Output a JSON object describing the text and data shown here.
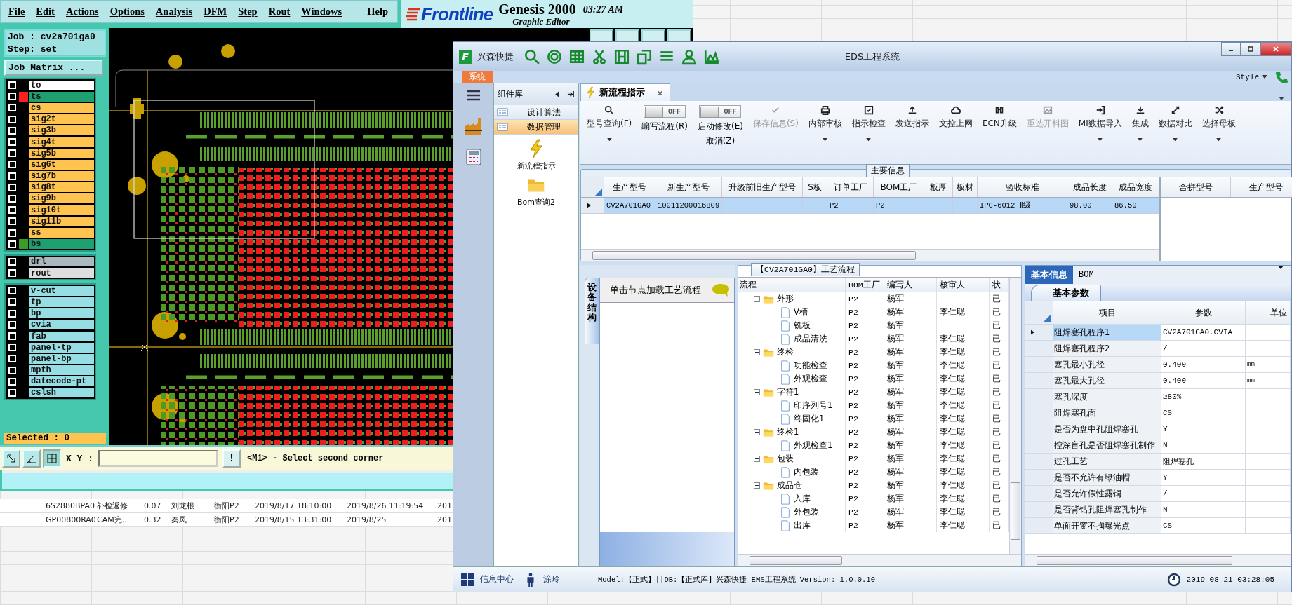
{
  "spreadsheet": {
    "rows": [
      [
        "6S2880BPA0",
        "补检返修",
        "0.07",
        "刘龙根",
        "衡阳P2",
        "2019/8/17 18:10:00",
        "2019/8/26 11:19:54",
        "201"
      ],
      [
        "GP00800RA0",
        "CAM完...",
        "0.32",
        "秦凤",
        "衡阳P2",
        "2019/8/15 13:31:00",
        "2019/8/25",
        "201"
      ]
    ]
  },
  "genesis": {
    "menu": [
      "File",
      "Edit",
      "Actions",
      "Options",
      "Analysis",
      "DFM",
      "Step",
      "Rout",
      "Windows",
      "Help"
    ],
    "logo": "Frontline",
    "product": "Genesis 2000",
    "subtitle": "Graphic Editor",
    "clock": "03:27 AM",
    "job": "Job : cv2a701ga0",
    "step": "Step: set",
    "job_matrix_button": "Job Matrix ...",
    "layer_groups": [
      {
        "layers": [
          {
            "name": "to",
            "color": "#ffffff",
            "checked": false
          },
          {
            "name": "ts",
            "color": "#1fa070",
            "checked": false,
            "swatch": {
              "color": "#ff1f1f"
            }
          },
          {
            "name": "cs",
            "color": "#ffc34f",
            "checked": false
          },
          {
            "name": "sig2t",
            "color": "#ffc34f",
            "checked": false
          },
          {
            "name": "sig3b",
            "color": "#ffc34f",
            "checked": false
          },
          {
            "name": "sig4t",
            "color": "#ffc34f",
            "checked": false
          },
          {
            "name": "sig5b",
            "color": "#ffc34f",
            "checked": false
          },
          {
            "name": "sig6t",
            "color": "#ffc34f",
            "checked": false
          },
          {
            "name": "sig7b",
            "color": "#ffc34f",
            "checked": false
          },
          {
            "name": "sig8t",
            "color": "#ffc34f",
            "checked": false
          },
          {
            "name": "sig9b",
            "color": "#ffc34f",
            "checked": false
          },
          {
            "name": "sig10t",
            "color": "#ffc34f",
            "checked": false
          },
          {
            "name": "sig11b",
            "color": "#ffc34f",
            "checked": false
          },
          {
            "name": "ss",
            "color": "#ffc34f",
            "checked": false
          },
          {
            "name": "bs",
            "color": "#1fa070",
            "checked": false,
            "swatch": {
              "color": "#3c9c28"
            }
          }
        ]
      },
      {
        "layers": [
          {
            "name": "drl",
            "color": "#a9b9bd",
            "checked": false
          },
          {
            "name": "rout",
            "color": "#dedede",
            "checked": false
          }
        ]
      },
      {
        "layers": [
          {
            "name": "v-cut",
            "color": "#96dde4",
            "checked": false
          },
          {
            "name": "tp",
            "color": "#96dde4",
            "checked": false
          },
          {
            "name": "bp",
            "color": "#96dde4",
            "checked": false
          },
          {
            "name": "cvia",
            "color": "#96dde4",
            "checked": false
          },
          {
            "name": "fab",
            "color": "#96dde4",
            "checked": false
          },
          {
            "name": "panel-tp",
            "color": "#96dde4",
            "checked": false
          },
          {
            "name": "panel-bp",
            "color": "#96dde4",
            "checked": false
          },
          {
            "name": "mpth",
            "color": "#96dde4",
            "checked": false
          },
          {
            "name": "datecode-pt",
            "color": "#96dde4",
            "checked": false
          },
          {
            "name": "cslsh",
            "color": "#96dde4",
            "checked": false
          }
        ]
      }
    ],
    "selected_count": "Selected : 0",
    "xy_label": "X Y :",
    "alert_button": "!",
    "prompt": "<M1> - Select second corner"
  },
  "eds": {
    "window": {
      "logo_letter": "F",
      "app_label": "兴森快捷",
      "title": "EDS工程系统",
      "menu_tab": "系统",
      "style_menu": "Style"
    },
    "component_panel": {
      "title": "组件库",
      "items": [
        {
          "label": "设计算法",
          "selected": false
        },
        {
          "label": "数据管理",
          "selected": true
        }
      ],
      "launchers": [
        "新流程指示",
        "Bom查询2"
      ]
    },
    "tabs": [
      {
        "label": "新流程指示",
        "selected": true,
        "close": "×"
      }
    ],
    "ribbon": [
      {
        "kind": "button",
        "label": "型号查询(F)",
        "dropdown": true,
        "disabled": false
      },
      {
        "kind": "toggle",
        "switch_text": "OFF",
        "on": false,
        "label": "编写流程(R)"
      },
      {
        "kind": "toggle",
        "switch_text": "OFF",
        "on": false,
        "label": "启动修改(E)",
        "label_2": "取消(Z)"
      },
      {
        "kind": "button",
        "label": "保存信息(S)",
        "dropdown": false,
        "disabled": true
      },
      {
        "kind": "button",
        "label": "内部审核",
        "dropdown": true,
        "disabled": false
      },
      {
        "kind": "button",
        "label": "指示检查",
        "dropdown": true,
        "disabled": false
      },
      {
        "kind": "button",
        "label": "发送指示",
        "dropdown": false,
        "disabled": false
      },
      {
        "kind": "button",
        "label": "文控上网",
        "dropdown": false,
        "disabled": false
      },
      {
        "kind": "button",
        "label": "ECN升级",
        "dropdown": false,
        "disabled": false
      },
      {
        "kind": "button",
        "label": "重选开料图",
        "dropdown": false,
        "disabled": true
      },
      {
        "kind": "button",
        "label": "MI数据导入",
        "dropdown": true,
        "disabled": false
      },
      {
        "kind": "button",
        "label": "集成",
        "dropdown": true,
        "disabled": false
      },
      {
        "kind": "button",
        "label": "数据对比",
        "dropdown": true,
        "disabled": false
      },
      {
        "kind": "button",
        "label": "选择母板",
        "dropdown": true,
        "disabled": false
      }
    ],
    "main_info": {
      "title": "主要信息",
      "columns": [
        "生产型号",
        "新生产型号",
        "升级前旧生产型号",
        "S板",
        "订单工厂",
        "BOM工厂",
        "板厚",
        "板材",
        "验收标准",
        "成品长度",
        "成品宽度"
      ],
      "rows": [
        {
          "selected": true,
          "cells": [
            "CV2A701GA0",
            "10011200016809",
            null,
            null,
            "P2",
            "P2",
            null,
            null,
            "IPC-6012 Ⅱ级",
            "98.00",
            "86.50"
          ]
        }
      ],
      "side_columns": [
        "合拼型号",
        "生产型号"
      ]
    },
    "device_panel": {
      "tab": "设备结构",
      "hint": "单击节点加载工艺流程"
    },
    "process": {
      "title": "【CV2A701GA0】工艺流程",
      "columns": [
        "流程",
        "BOM工厂",
        "编写人",
        "核审人",
        "状"
      ],
      "nodes": [
        {
          "label": "外形",
          "bom": "P2",
          "writer": "杨军",
          "status": "已",
          "expanded": true,
          "children": [
            {
              "label": "V槽",
              "bom": "P2",
              "writer": "杨军",
              "reviewer": "李仁聪",
              "status": "已"
            },
            {
              "label": "铣板",
              "bom": "P2",
              "writer": "杨军",
              "status": "已"
            },
            {
              "label": "成品清洗",
              "bom": "P2",
              "writer": "杨军",
              "reviewer": "李仁聪",
              "status": "已"
            }
          ]
        },
        {
          "label": "终检",
          "bom": "P2",
          "writer": "杨军",
          "reviewer": "李仁聪",
          "status": "已",
          "expanded": true,
          "children": [
            {
              "label": "功能检查",
              "bom": "P2",
              "writer": "杨军",
              "reviewer": "李仁聪",
              "status": "已"
            },
            {
              "label": "外观检查",
              "bom": "P2",
              "writer": "杨军",
              "reviewer": "李仁聪",
              "status": "已"
            }
          ]
        },
        {
          "label": "字符1",
          "bom": "P2",
          "writer": "杨军",
          "reviewer": "李仁聪",
          "status": "已",
          "expanded": true,
          "children": [
            {
              "label": "印序列号1",
              "bom": "P2",
              "writer": "杨军",
              "reviewer": "李仁聪",
              "status": "已"
            },
            {
              "label": "终固化1",
              "bom": "P2",
              "writer": "杨军",
              "reviewer": "李仁聪",
              "status": "已"
            }
          ]
        },
        {
          "label": "终检1",
          "bom": "P2",
          "writer": "杨军",
          "reviewer": "李仁聪",
          "status": "已",
          "expanded": true,
          "children": [
            {
              "label": "外观检查1",
              "bom": "P2",
              "writer": "杨军",
              "reviewer": "李仁聪",
              "status": "已"
            }
          ]
        },
        {
          "label": "包装",
          "bom": "P2",
          "writer": "杨军",
          "reviewer": "李仁聪",
          "status": "已",
          "expanded": true,
          "children": [
            {
              "label": "内包装",
              "bom": "P2",
              "writer": "杨军",
              "reviewer": "李仁聪",
              "status": "已"
            }
          ]
        },
        {
          "label": "成品仓",
          "bom": "P2",
          "writer": "杨军",
          "reviewer": "李仁聪",
          "status": "已",
          "expanded": true,
          "children": [
            {
              "label": "入库",
              "bom": "P2",
              "writer": "杨军",
              "reviewer": "李仁聪",
              "status": "已"
            },
            {
              "label": "外包装",
              "bom": "P2",
              "writer": "杨军",
              "reviewer": "李仁聪",
              "status": "已"
            },
            {
              "label": "出库",
              "bom": "P2",
              "writer": "杨军",
              "reviewer": "李仁聪",
              "status": "已"
            }
          ]
        }
      ]
    },
    "basic_info": {
      "tabs": [
        {
          "label": "基本信息",
          "selected": true
        },
        {
          "label": "BOM",
          "selected": false
        }
      ],
      "subtab": "基本参数",
      "columns": [
        "项目",
        "参数",
        "单位"
      ],
      "rows": [
        {
          "item": "阻焊塞孔程序1",
          "value": "CV2A701GA0.CVIA",
          "selected": true
        },
        {
          "item": "阻焊塞孔程序2",
          "value": "/",
          "selected": false
        },
        {
          "item": "塞孔最小孔径",
          "value": "0.400",
          "unit": "mm",
          "selected": false
        },
        {
          "item": "塞孔最大孔径",
          "value": "0.400",
          "unit": "mm",
          "selected": false
        },
        {
          "item": "塞孔深度",
          "value": "≥80%",
          "selected": false
        },
        {
          "item": "阻焊塞孔面",
          "value": "CS",
          "selected": false
        },
        {
          "item": "是否为盘中孔阻焊塞孔",
          "value": "Y",
          "selected": false
        },
        {
          "item": "控深盲孔是否阻焊塞孔制作",
          "value": "N",
          "selected": false
        },
        {
          "item": "过孔工艺",
          "value": "阻焊塞孔",
          "selected": false
        },
        {
          "item": "是否不允许有绿油帽",
          "value": "Y",
          "selected": false
        },
        {
          "item": "是否允许假性露铜",
          "value": "/",
          "selected": false
        },
        {
          "item": "是否背钻孔阻焊塞孔制作",
          "value": "N",
          "selected": false
        },
        {
          "item": "单面开窗不掏曝光点",
          "value": "CS",
          "selected": false
        }
      ]
    },
    "status_bar": {
      "info_center": "信息中心",
      "user": "涂玲",
      "model": "Model:【正式】||DB:【正式库】兴森快捷 EMS工程系统 Version: 1.0.0.10",
      "time": "2019-08-21 03:28:05"
    }
  }
}
